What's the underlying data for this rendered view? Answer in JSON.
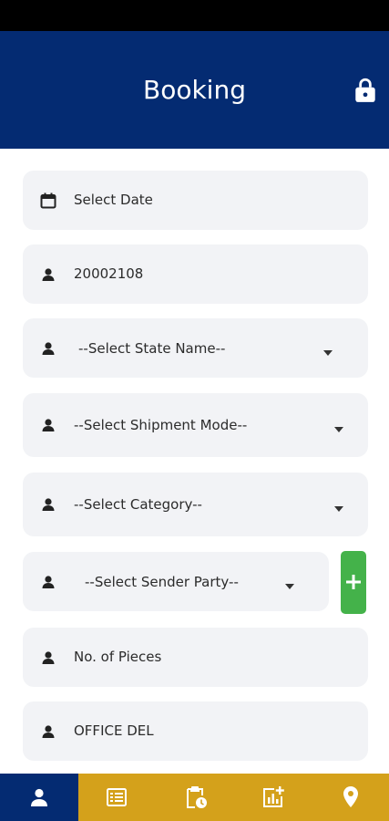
{
  "app_bar": {
    "title": "Booking",
    "lock_icon": "lock-icon",
    "background_color": "#042b72"
  },
  "form": {
    "date": {
      "placeholder": "Select Date",
      "icon": "calendar-icon"
    },
    "id_field": {
      "value": "20002108",
      "icon": "person-icon"
    },
    "state": {
      "selected": "--Select State Name--",
      "icon": "person-icon"
    },
    "shipment_mode": {
      "selected": "--Select Shipment Mode--",
      "icon": "person-icon"
    },
    "category": {
      "selected": "--Select Category--",
      "icon": "person-icon"
    },
    "sender_party": {
      "selected": "--Select Sender Party--",
      "icon": "person-icon",
      "add_icon": "plus-icon"
    },
    "pieces": {
      "placeholder": "No. of Pieces",
      "icon": "person-icon"
    },
    "office": {
      "value": "OFFICE DEL",
      "icon": "person-icon"
    }
  },
  "bottom_nav": {
    "active_index": 0,
    "items": [
      {
        "icon": "person-icon"
      },
      {
        "icon": "list-icon"
      },
      {
        "icon": "clipboard-clock-icon"
      },
      {
        "icon": "chart-add-icon"
      },
      {
        "icon": "location-pin-icon"
      }
    ],
    "background_color": "#d4a11b",
    "active_color": "#042b72"
  }
}
